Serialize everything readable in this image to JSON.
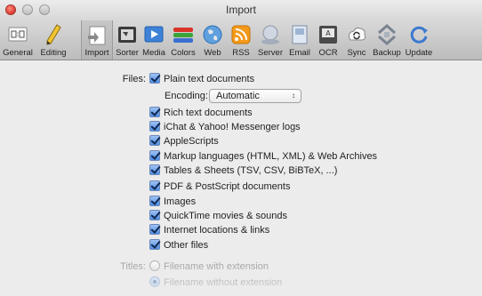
{
  "window": {
    "title": "Import"
  },
  "toolbar": {
    "items": [
      {
        "label": "General",
        "icon": "general-icon"
      },
      {
        "label": "Editing",
        "icon": "pencil-icon"
      },
      {
        "label": "Import",
        "icon": "import-icon",
        "selected": true
      },
      {
        "label": "Sorter",
        "icon": "sorter-icon"
      },
      {
        "label": "Media",
        "icon": "media-icon"
      },
      {
        "label": "Colors",
        "icon": "colors-icon"
      },
      {
        "label": "Web",
        "icon": "globe-icon"
      },
      {
        "label": "RSS",
        "icon": "rss-icon"
      },
      {
        "label": "Server",
        "icon": "server-icon"
      },
      {
        "label": "Email",
        "icon": "email-icon"
      },
      {
        "label": "OCR",
        "icon": "ocr-icon"
      },
      {
        "label": "Sync",
        "icon": "sync-icon"
      },
      {
        "label": "Backup",
        "icon": "backup-icon"
      },
      {
        "label": "Update",
        "icon": "update-icon"
      }
    ]
  },
  "files": {
    "label": "Files:",
    "plain_text": "Plain text documents",
    "encoding_label": "Encoding:",
    "encoding_value": "Automatic",
    "options": [
      "Rich text documents",
      "iChat & Yahoo! Messenger logs",
      "AppleScripts",
      "Markup languages (HTML, XML) & Web Archives",
      "Tables & Sheets (TSV, CSV, BiBTeX, ...)",
      "PDF & PostScript documents",
      "Images",
      "QuickTime movies & sounds",
      "Internet locations & links",
      "Other files"
    ]
  },
  "titles": {
    "label": "Titles:",
    "options": [
      {
        "label": "Filename with extension",
        "selected": false
      },
      {
        "label": "Filename without extension",
        "selected": true
      }
    ]
  },
  "colors": {
    "accent": "#4e8de3"
  }
}
